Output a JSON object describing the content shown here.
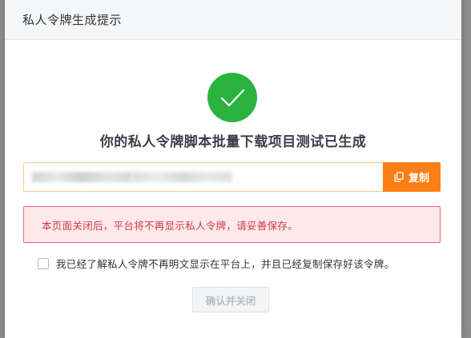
{
  "modal": {
    "title": "私人令牌生成提示",
    "headline": "你的私人令牌脚本批量下载项目测试已生成",
    "copy_label": "复制",
    "warning_text": "本页面关闭后，平台将不再显示私人令牌，请妥善保存。",
    "confirm_text": "我已经了解私人令牌不再明文显示在平台上，并且已经复制保存好该令牌。",
    "close_label": "确认并关闭",
    "close_disabled": true,
    "confirm_checked": false
  },
  "icons": {
    "success": "check-circle-icon",
    "copy": "copy-icon"
  },
  "colors": {
    "success": "#2ab33f",
    "accent": "#fd7e14",
    "danger_text": "#d23a48",
    "danger_bg": "#fde9ea",
    "danger_border": "#e36d77"
  }
}
